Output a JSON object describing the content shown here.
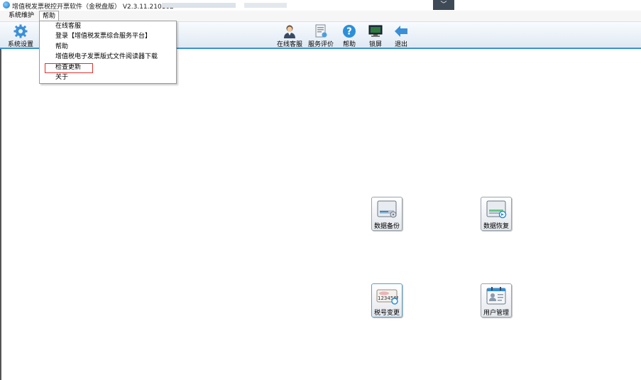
{
  "window": {
    "title": "增值税发票税控开票软件（金税盘版） V2.3.11.210102",
    "dropdown_glyph": "﹀"
  },
  "menubar": {
    "items": [
      {
        "label": "系统维护"
      },
      {
        "label": "帮助"
      }
    ]
  },
  "help_menu": {
    "items": [
      {
        "label": "在线客服"
      },
      {
        "label": "登录【增值税发票综合服务平台】"
      },
      {
        "label": "帮助"
      },
      {
        "label": "增值税电子发票版式文件阅读器下载"
      },
      {
        "label": "检查更新"
      },
      {
        "label": "关于"
      }
    ]
  },
  "toolbar": {
    "system_settings": "系统设置",
    "online_service": "在线客服",
    "service_rating": "服务评价",
    "help": "帮助",
    "lock_screen": "锁屏",
    "exit": "退出"
  },
  "tiles": {
    "data_backup": "数据备份",
    "data_restore": "数据恢复",
    "tax_id_change": "税号变更",
    "user_management": "用户管理",
    "tax_id_sample": "123456F"
  },
  "colors": {
    "accent_blue": "#3a93d8",
    "highlight_red": "#e0302a"
  }
}
